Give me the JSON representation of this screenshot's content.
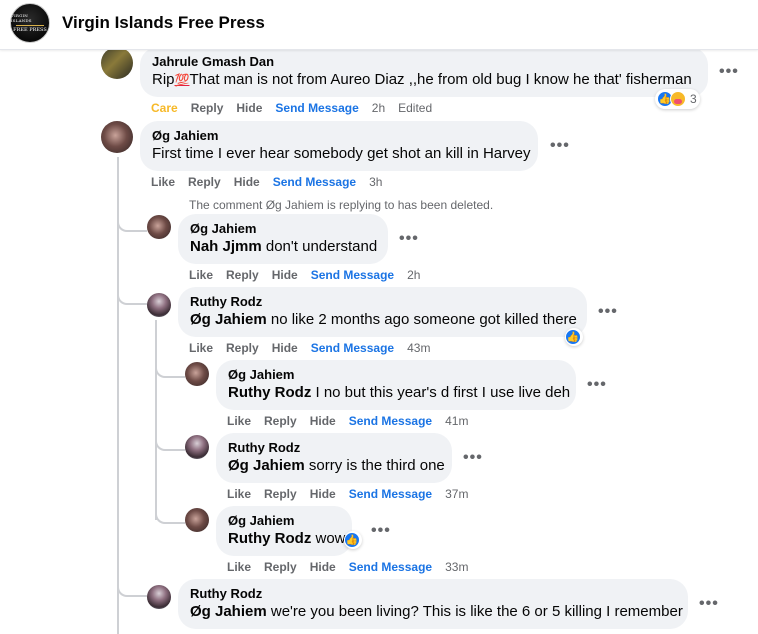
{
  "page": {
    "title": "Virgin Islands Free Press",
    "logo_text_top": "VIRGIN ISLANDS",
    "logo_text_bottom": "FREE PRESS"
  },
  "actions": {
    "like": "Like",
    "care": "Care",
    "reply": "Reply",
    "hide": "Hide",
    "send_message": "Send Message",
    "edited": "Edited"
  },
  "deleted_note": "The comment Øg Jahiem is replying to has been deleted.",
  "comments": [
    {
      "author": "Jahrule Gmash Dan",
      "text_before": "Rip",
      "emoji": "💯",
      "text": "That man is not from Aureo Diaz ,,he from old bug I know he that' fisherman",
      "time": "2h",
      "reaction_count": "3"
    },
    {
      "author": "Øg Jahiem",
      "text": "First time I ever hear somebody get shot an kill in Harvey",
      "time": "3h"
    },
    {
      "author": "Øg Jahiem",
      "mention": "Nah Jjmm",
      "text": " don't understand",
      "time": "2h"
    },
    {
      "author": "Ruthy Rodz",
      "mention": "Øg Jahiem",
      "text": " no like 2 months ago someone got killed there",
      "time": "43m"
    },
    {
      "author": "Øg Jahiem",
      "mention": "Ruthy Rodz",
      "text": " I no but this year's d first I use live deh",
      "time": "41m"
    },
    {
      "author": "Ruthy Rodz",
      "mention": "Øg Jahiem",
      "text": " sorry is the third one",
      "time": "37m"
    },
    {
      "author": "Øg Jahiem",
      "mention": "Ruthy Rodz",
      "text": " wow",
      "time": "33m"
    },
    {
      "author": "Ruthy Rodz",
      "mention": "Øg Jahiem",
      "text": " we're you been living? This is like the 6 or 5 killing I remember"
    }
  ],
  "icons": {
    "more": "more-options-icon",
    "like_reaction": "like-reaction-icon",
    "care_reaction": "care-reaction-icon"
  },
  "colors": {
    "link_blue": "#1b74e4",
    "care_yellow": "#f7b928",
    "bubble_bg": "#f0f2f5",
    "meta_gray": "#65676b"
  }
}
